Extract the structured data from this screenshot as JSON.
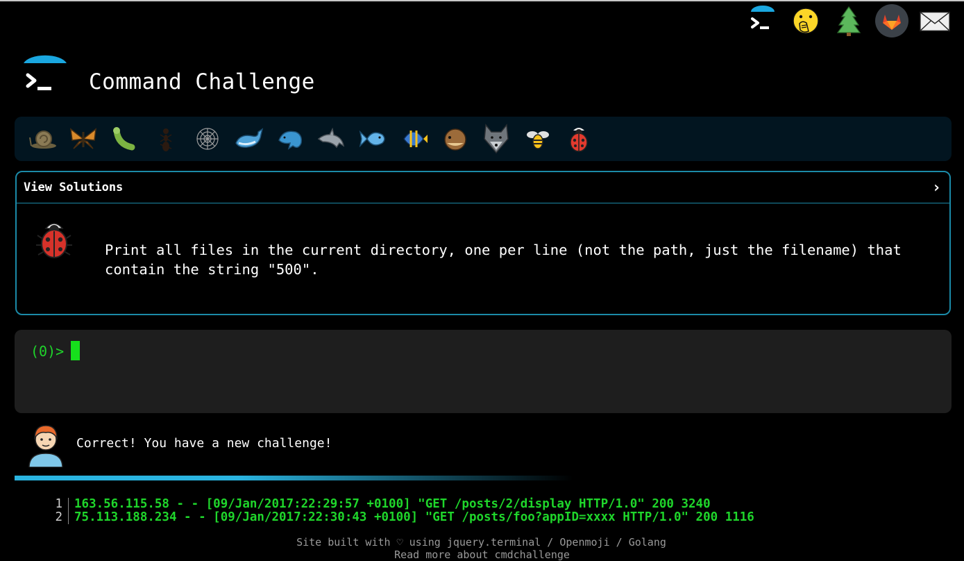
{
  "header": {
    "title": "Command Challenge"
  },
  "top_icons": [
    "terminal-icon",
    "face-with-hand-over-mouth-icon",
    "tree-icon",
    "gitlab-icon",
    "mail-icon"
  ],
  "animals": [
    "snail-icon",
    "butterfly-icon",
    "bug-icon",
    "ant-icon",
    "spider-web-icon",
    "whale-icon",
    "dolphin-icon",
    "dolphin-gray-icon",
    "fish-icon",
    "tropical-fish-icon",
    "blowfish-icon",
    "wolf-icon",
    "bee-icon",
    "ladybug-icon"
  ],
  "challenge": {
    "header_label": "View Solutions",
    "text": "Print all files in the current directory, one per line (not the path, just the filename) that contain the string \"500\"."
  },
  "terminal": {
    "prompt": "(0)>"
  },
  "feedback": {
    "message": "Correct! You have a new challenge!"
  },
  "file_output": [
    {
      "n": "1",
      "text": "163.56.115.58 - - [09/Jan/2017:22:29:57 +0100] \"GET /posts/2/display HTTP/1.0\" 200 3240"
    },
    {
      "n": "2",
      "text": "75.113.188.234 - - [09/Jan/2017:22:30:43 +0100] \"GET /posts/foo?appID=xxxx HTTP/1.0\" 200 1116"
    }
  ],
  "footer": {
    "line1": "Site built with ♡ using jquery.terminal / Openmoji / Golang",
    "line2": "Read more about cmdchallenge"
  },
  "colors": {
    "accent": "#1b8aa8",
    "prompt": "#1fd62b",
    "bar": "#021520"
  }
}
